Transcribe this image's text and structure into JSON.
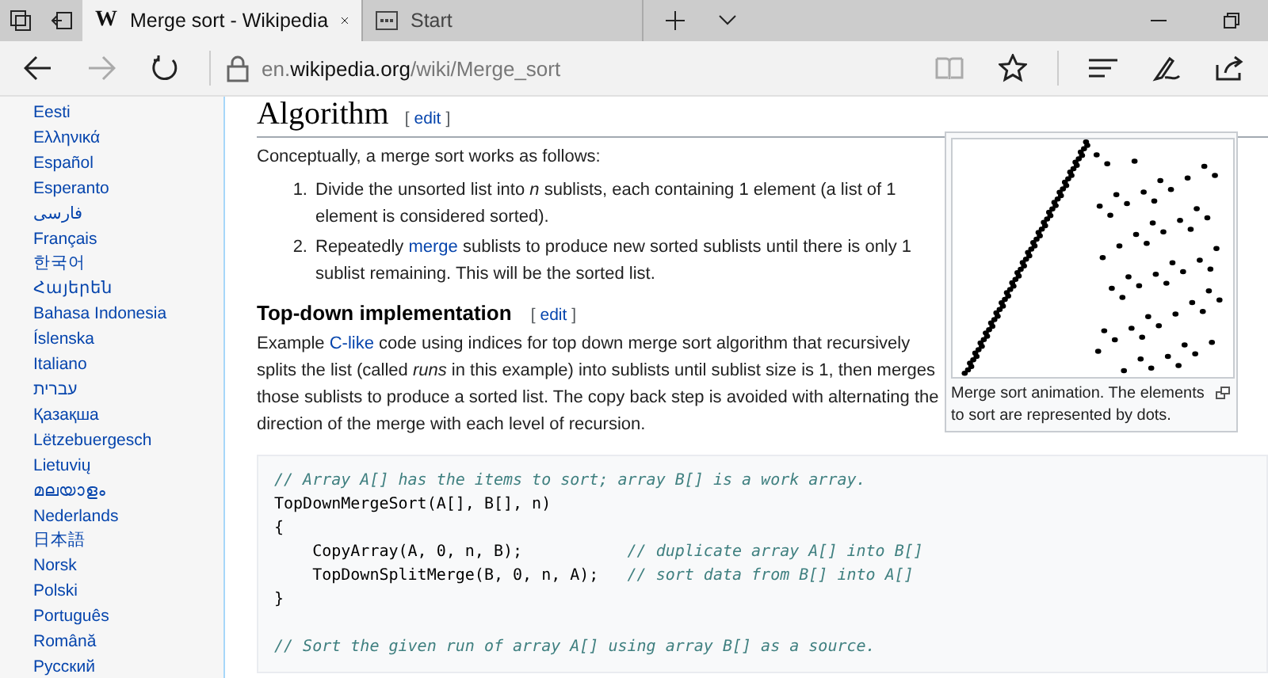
{
  "tabs": [
    {
      "title": "Merge sort - Wikipedia",
      "selected": true,
      "kind": "wiki",
      "icon_text": "W"
    },
    {
      "title": "Start",
      "selected": false,
      "kind": "start"
    }
  ],
  "address": {
    "host_prefix": "en.",
    "host": "wikipedia.org",
    "path": "/wiki/Merge_sort"
  },
  "languages": [
    "Eesti",
    "Ελληνικά",
    "Español",
    "Esperanto",
    "فارسی",
    "Français",
    "한국어",
    "Հայերեն",
    "Bahasa Indonesia",
    "Íslenska",
    "Italiano",
    "עברית",
    "Қазақша",
    "Lëtzebuergesch",
    "Lietuvių",
    "മലയാളം",
    "Nederlands",
    "日本語",
    "Norsk",
    "Polski",
    "Português",
    "Română",
    "Русский"
  ],
  "heading": {
    "title": "Algorithm",
    "open": "[",
    "edit": "edit",
    "close": "]"
  },
  "intro": "Conceptually, a merge sort works as follows:",
  "steps": [
    {
      "number": "1.",
      "text": "Divide the unsorted list into *n* sublists, each containing 1 element (a list of 1 element is considered sorted)."
    },
    {
      "number": "2.",
      "before": "Repeatedly ",
      "link": "merge",
      "after": " sublists to produce new sorted sublists until there is only 1 sublist remaining. This will be the sorted list."
    }
  ],
  "subheading": {
    "title": "Top-down implementation",
    "open": "[",
    "edit": "edit",
    "close": "]"
  },
  "paragraph": {
    "before": "Example ",
    "link": "C-like",
    "after": " code using indices for top down merge sort algorithm that recursively splits the list (called *runs* in this example) into sublists until sublist size is 1, then merges those sublists to produce a sorted list. The copy back step is avoided with alternating the direction of the merge with each level of recursion."
  },
  "figure": {
    "caption": "Merge sort animation. The elements to sort are represented by dots."
  },
  "code": [
    {
      "kind": "text",
      "comment": "// Array A[] has the items to sort; array B[] is a work array."
    },
    {
      "kind": "text",
      "code": "TopDownMergeSort(A[], B[], n)"
    },
    {
      "kind": "text",
      "code": "{"
    },
    {
      "kind": "text",
      "code": "    CopyArray(A, 0, n, B);           ",
      "comment": "// duplicate array A[] into B[]"
    },
    {
      "kind": "text",
      "code": "    TopDownSplitMerge(B, 0, n, A);   ",
      "comment": "// sort data from B[] into A[]"
    },
    {
      "kind": "text",
      "code": "}"
    },
    {
      "kind": "blank"
    },
    {
      "kind": "text",
      "comment": "// Sort the given run of array A[] using array B[] as a source."
    }
  ]
}
